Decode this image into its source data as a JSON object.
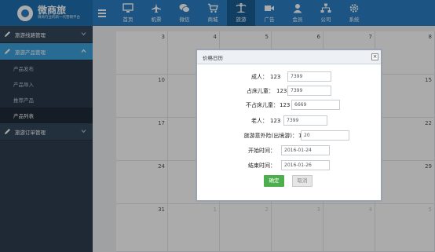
{
  "app": {
    "title": "微商旅",
    "subtitle": "微商行业的新一代营销平台"
  },
  "topnav": [
    {
      "label": "首页",
      "icon": "monitor-icon"
    },
    {
      "label": "机票",
      "icon": "airplane-icon"
    },
    {
      "label": "微信",
      "icon": "wechat-icon"
    },
    {
      "label": "商城",
      "icon": "cart-icon"
    },
    {
      "label": "旅游",
      "icon": "island-icon",
      "active": true
    },
    {
      "label": "广告",
      "icon": "video-icon"
    },
    {
      "label": "会员",
      "icon": "user-icon"
    },
    {
      "label": "公司",
      "icon": "sitemap-icon"
    },
    {
      "label": "系统",
      "icon": "gear-icon"
    }
  ],
  "sidebar": {
    "sections": [
      {
        "label": "旅游线路管理",
        "active": false,
        "items": []
      },
      {
        "label": "旅游产品管理",
        "active": true,
        "items": [
          {
            "label": "产品发布",
            "active": false
          },
          {
            "label": "产品导入",
            "active": false
          },
          {
            "label": "推荐产品",
            "active": false
          },
          {
            "label": "产品列表",
            "active": true
          }
        ]
      },
      {
        "label": "旅游订单管理",
        "active": false,
        "items": []
      }
    ]
  },
  "calendar": {
    "rows": [
      [
        "",
        "3",
        "4",
        "5",
        "6",
        "7",
        "8"
      ],
      [
        "",
        "10",
        "",
        "",
        "",
        "",
        "15"
      ],
      [
        "",
        "17",
        "",
        "",
        "",
        "",
        "22"
      ],
      [
        "",
        "24",
        "",
        "",
        "",
        "",
        "29"
      ],
      [
        "",
        "31",
        "1",
        "2",
        "3",
        "4",
        "5"
      ]
    ],
    "faded_last_row": true
  },
  "dialog": {
    "title": "价格日历",
    "close": "×",
    "fields": [
      {
        "label": "成人：",
        "number": "123",
        "value": "7399"
      },
      {
        "label": "占床儿童：",
        "number": "123",
        "value": "7399"
      },
      {
        "label": "不占床儿童：",
        "number": "123",
        "value": "6669"
      },
      {
        "label": "老人：",
        "number": "123",
        "value": "7399"
      },
      {
        "label": "旅游意外险(出境游)：",
        "number": "123",
        "value": "20"
      },
      {
        "label": "开始时间：",
        "number": "",
        "value": "2016-01-24"
      },
      {
        "label": "结束时间：",
        "number": "",
        "value": "2016-01-26"
      }
    ],
    "ok_label": "确定",
    "cancel_label": "取消"
  }
}
